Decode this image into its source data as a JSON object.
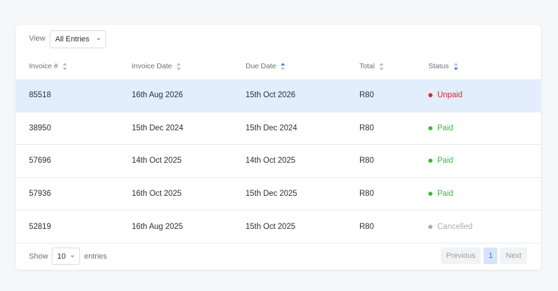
{
  "colors": {
    "accent": "#3d7fe0",
    "selected_row": "#e3eefc",
    "unpaid": "#e0252f",
    "paid": "#3db548",
    "cancelled": "#a9aeb3"
  },
  "toolbar": {
    "view_label": "View",
    "view_value": "All Entries"
  },
  "table": {
    "columns": [
      {
        "label": "Invoice #",
        "sort": "none"
      },
      {
        "label": "Invoice Date",
        "sort": "none"
      },
      {
        "label": "Due Date",
        "sort": "asc"
      },
      {
        "label": "Total",
        "sort": "none"
      },
      {
        "label": "Status",
        "sort": "desc"
      }
    ],
    "rows": [
      {
        "invoice": "85518",
        "date": "16th Aug 2026",
        "due": "15th Oct 2026",
        "total": "R80",
        "status": "Unpaid",
        "status_key": "unpaid",
        "selected": true
      },
      {
        "invoice": "38950",
        "date": "15th Dec 2024",
        "due": "15th Dec 2024",
        "total": "R80",
        "status": "Paid",
        "status_key": "paid",
        "selected": false
      },
      {
        "invoice": "57696",
        "date": "14th Oct 2025",
        "due": "14th Oct 2025",
        "total": "R80",
        "status": "Paid",
        "status_key": "paid",
        "selected": false
      },
      {
        "invoice": "57936",
        "date": "16th Oct 2025",
        "due": "15th Dec 2025",
        "total": "R80",
        "status": "Paid",
        "status_key": "paid",
        "selected": false
      },
      {
        "invoice": "52819",
        "date": "16th Aug 2025",
        "due": "15th Oct 2025",
        "total": "R80",
        "status": "Cancelled",
        "status_key": "cancelled",
        "selected": false
      }
    ]
  },
  "footer": {
    "show_label": "Show",
    "length_value": "10",
    "entries_label": "entries",
    "previous_label": "Previous",
    "page": "1",
    "next_label": "Next"
  }
}
